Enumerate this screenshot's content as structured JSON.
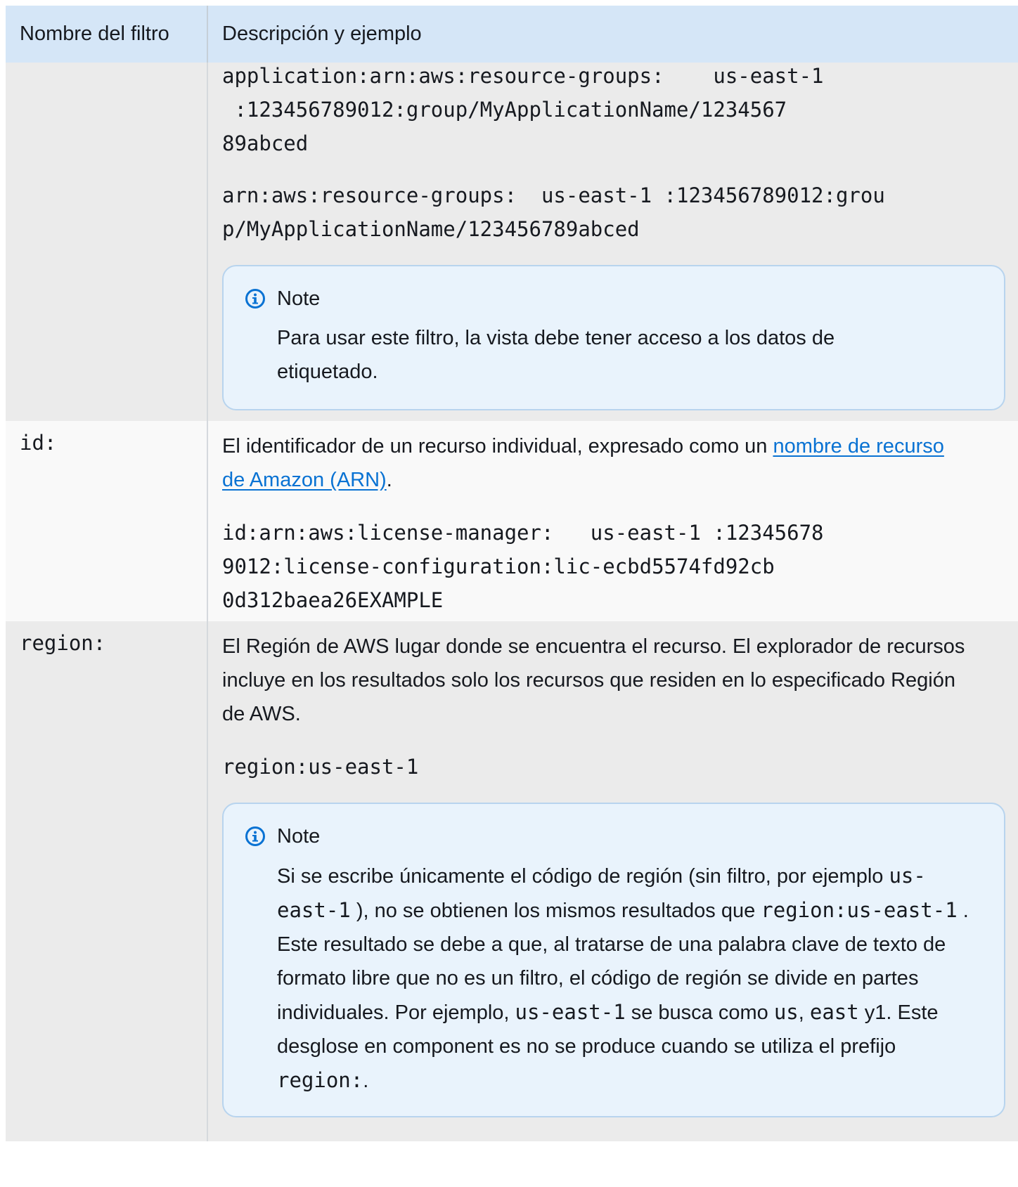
{
  "header": {
    "col_name": "Nombre del filtro",
    "col_desc": "Descripción y ejemplo"
  },
  "rows": [
    {
      "name": "",
      "code1_lines": [
        "application:arn:aws:resource-groups:    us-east-1",
        " :123456789012:group/MyApplicationName/1234567",
        "89abced"
      ],
      "code2_lines": [
        "arn:aws:resource-groups:  us-east-1 :123456789012:grou",
        "p/MyApplicationName/123456789abced"
      ],
      "note": {
        "title": "Note",
        "text": "Para usar este filtro, la vista debe tener acceso a los datos de etiquetado."
      }
    },
    {
      "name": "id:",
      "desc_before_link": "El identificador de un recurso individual, expresado como un ",
      "link": "nombre de recurso de Amazon (ARN)",
      "desc_after_link": ".",
      "code_lines": [
        "id:arn:aws:license-manager:   us-east-1 :12345678",
        "9012:license-configuration:lic-ecbd5574fd92cb",
        "0d312baea26EXAMPLE"
      ]
    },
    {
      "name": "region:",
      "desc": "El Región de AWS lugar donde se encuentra el recurso. El explorador de recursos incluye en los resultados solo los recursos que residen en lo especificado Región de AWS.",
      "code": "region:us-east-1",
      "note": {
        "title": "Note",
        "t1": "Si se escribe únicamente el código de región (sin filtro, por ejemplo ",
        "c1": "us-east-1",
        "t2": " ), no se obtienen los mismos resultados que ",
        "c2": "region:us-east-1",
        "t3": " . Este resultado se debe a que, al tratarse de una palabra clave de texto de formato libre que no es un filtro, el código de región se divide en partes individuales. Por ejemplo, ",
        "c3": "us-east-1",
        "t4": "  se busca como ",
        "c4": "us",
        "t5": ", ",
        "c5": "east",
        "t6": " y1. Este desglose en component es no se produce cuando se utiliza el prefijo ",
        "c6": "region:",
        "t7": "."
      }
    }
  ],
  "colors": {
    "header_bg": "#d5e6f7",
    "row_alt_bg": "#ebebeb",
    "note_bg": "#e9f3fc",
    "note_border": "#b8d4ee",
    "link": "#0972d3",
    "info_icon": "#0972d3"
  },
  "icons": {
    "note": "info-circle-icon"
  }
}
